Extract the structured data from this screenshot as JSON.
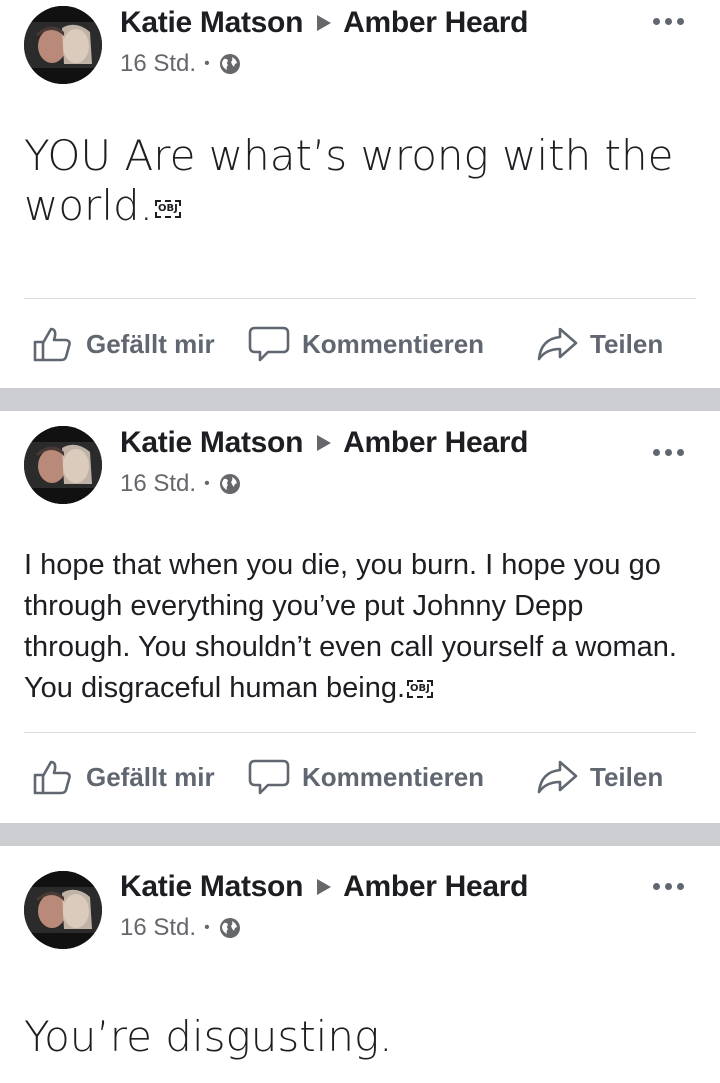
{
  "colors": {
    "separator": "#cbcdd1",
    "secondary_text": "#65676b",
    "action_text": "#606770",
    "primary_text": "#1c1e21"
  },
  "posts": [
    {
      "author": "Katie Matson",
      "target": "Amber Heard",
      "time": "16 Std.",
      "privacy_icon": "globe-icon",
      "text": "YOU Are what’s wrong with the world.",
      "object_placeholder": "OBJ",
      "actions": {
        "like": "Gefällt mir",
        "comment": "Kommentieren",
        "share": "Teilen"
      }
    },
    {
      "author": "Katie Matson",
      "target": "Amber Heard",
      "time": "16 Std.",
      "privacy_icon": "globe-icon",
      "text": "I hope that when you die, you burn. I hope you go through everything you’ve put Johnny Depp through. You shouldn’t even call yourself a woman. You disgraceful human being.",
      "object_placeholder": "OBJ",
      "actions": {
        "like": "Gefällt mir",
        "comment": "Kommentieren",
        "share": "Teilen"
      }
    },
    {
      "author": "Katie Matson",
      "target": "Amber Heard",
      "time": "16 Std.",
      "privacy_icon": "globe-icon",
      "text": "You’re disgusting."
    }
  ]
}
